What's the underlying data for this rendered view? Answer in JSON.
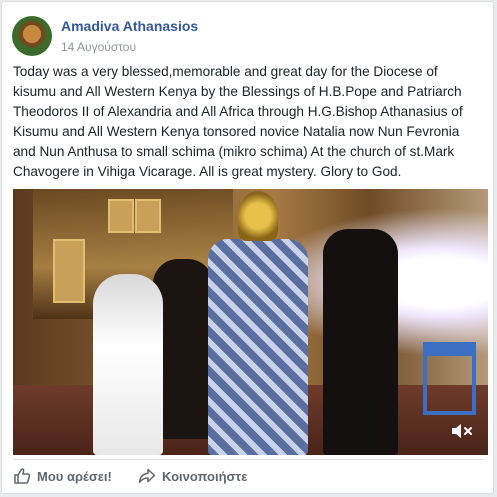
{
  "post": {
    "author": "Amadiva Athanasios",
    "timestamp": "14 Αυγούστου",
    "text": "Today was a very blessed,memorable and great day for the Diocese of kisumu and All Western Kenya by the Blessings of H.B.Pope and Patriarch Theodoros II of Alexandria and All Africa through H.G.Bishop Athanasius of Kisumu and All Western Kenya tonsored novice Natalia now Nun Fevronia and Nun Anthusa to small schima (mikro schima) At the church of st.Mark Chavogere in Vihiga Vicarage. All is great mystery. Glory to God."
  },
  "video": {
    "mute_icon": "speaker-muted-icon"
  },
  "actions": {
    "like_label": "Μου αρέσει!",
    "like_icon": "thumbs-up-icon",
    "share_label": "Κοινοποιήστε",
    "share_icon": "share-arrow-icon"
  },
  "colors": {
    "author_link": "#365899",
    "text": "#1d2129",
    "meta": "#90949c",
    "action": "#606770"
  }
}
